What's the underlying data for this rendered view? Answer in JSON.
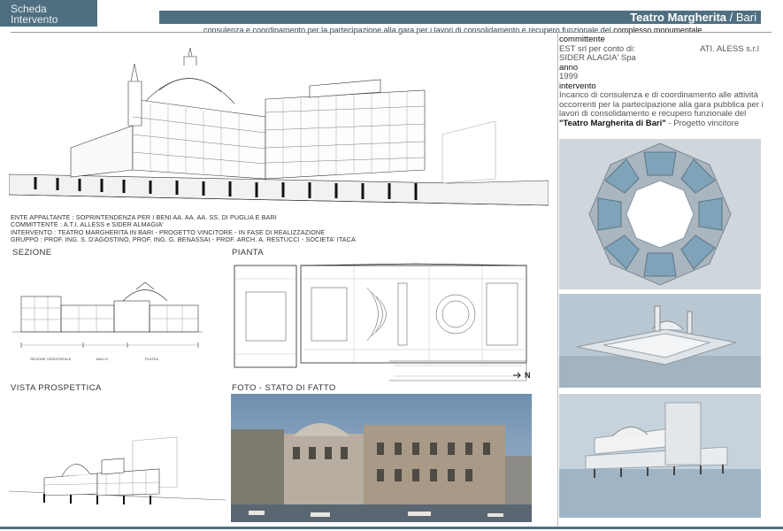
{
  "header": {
    "logo_line1": "Scheda",
    "logo_line2": "Intervento",
    "title": "Teatro Margherita",
    "title_sep": " / ",
    "city": "Bari",
    "subtitle_prefix": "consulenza e coordinamento  per la partecipazione alla gara  per i lavori di consolidamento e recupero funzionale del ",
    "subtitle_strong": "complesso monumentale"
  },
  "info": {
    "committente_label": "committente",
    "committente_for": "EST srl  per conto di:",
    "committente_ati": "ATI. ALESS s.r.l",
    "committente_2": "SIDER ALAGIA' Spa",
    "anno_label": "anno",
    "anno_value": "1999",
    "intervento_label": "intervento",
    "intervento_text": "Incarico di consulenza e di coordinamento alle attività occorrenti per la partecipazione alla gara pubblica per i lavori di consolidamento e recupero funzionale del",
    "project_name": "\"Teatro Margherita di Bari\"",
    "project_result": " - Progetto vincitore"
  },
  "credits": [
    "ENTE APPALTANTE : SOPRINTENDENZA PER I BENI AA. AA. AA. SS. DI PUGLIA E BARI",
    "COMMITTENTE : A.T.I. ALLESS e SIDER ALMAGIA'",
    "INTERVENTO : TEATRO MARGHERITA IN BARI - PROGETTO VINCITORE - IN FASE DI REALIZZAZIONE",
    "GRUPPO : PROF. ING. S. D'AGOSTINO, PROF. ING. G. BENASSAI - PROF. ARCH. A. RESTUCCI - SOCIETA' ITACA"
  ],
  "sections": {
    "sezione": "SEZIONE",
    "pianta": "PIANTA",
    "vista": "VISTA PROSPETTICA",
    "foto": "FOTO - STATO DI FATTO"
  },
  "drawing_labels": {
    "north": "N",
    "sez_a": "SEZIONE ORIZZONTALE",
    "sez_b": "BALLO",
    "sez_c": "PLATEA"
  },
  "colors": {
    "accent": "#4f6f80",
    "render_blue": "#b9c7d3",
    "render_sea": "#9fb4c4"
  }
}
